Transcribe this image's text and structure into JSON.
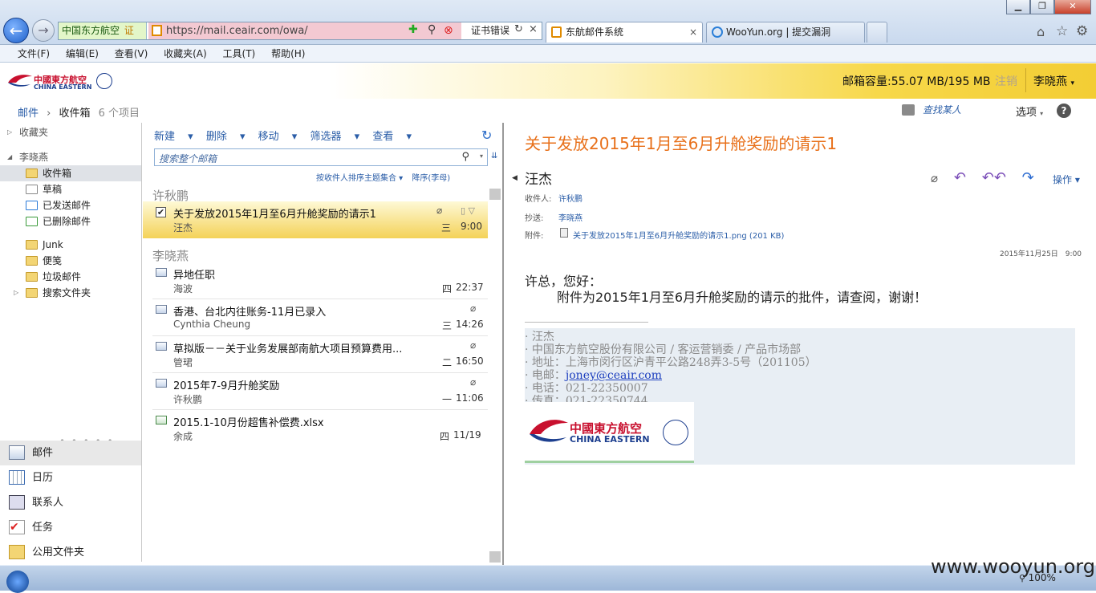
{
  "browser": {
    "cert_label": "中国东方航空",
    "cert_badge": "证",
    "url": "https://mail.ceair.com/owa/",
    "cert_error": "证书错误",
    "tabs": [
      {
        "label": "东航邮件系统",
        "close": "×"
      },
      {
        "label": "WooYun.org | 提交漏洞"
      }
    ],
    "menu": [
      "文件(F)",
      "编辑(E)",
      "查看(V)",
      "收藏夹(A)",
      "工具(T)",
      "帮助(H)"
    ],
    "zoom": "100%"
  },
  "header": {
    "logo_cn": "中國東方航空",
    "logo_en": "CHINA EASTERN",
    "quota": "邮箱容量:55.07 MB/195 MB",
    "logout": "注销",
    "user": "李晓燕"
  },
  "breadcrumb": {
    "root": "邮件",
    "sep": "›",
    "folder": "收件箱",
    "count": "6 个项目"
  },
  "find_people": "查找某人",
  "options": "选项",
  "help": "?",
  "nav": {
    "favorites": "收藏夹",
    "account": "李晓燕",
    "folders": [
      "收件箱",
      "草稿",
      "已发送邮件",
      "已删除邮件",
      "Junk",
      "便笺",
      "垃圾邮件",
      "搜索文件夹"
    ],
    "grip": "• • • • •",
    "bottom": [
      "邮件",
      "日历",
      "联系人",
      "任务",
      "公用文件夹"
    ]
  },
  "list": {
    "toolbar": [
      "新建",
      "删除",
      "移动",
      "筛选器",
      "查看"
    ],
    "search_placeholder": "搜索整个邮箱",
    "sort_by": "按收件人排序主题集合",
    "sort_order": "降序(李母)",
    "groups": [
      "许秋鹏",
      "李晓燕"
    ],
    "messages": [
      {
        "subject": "关于发放2015年1月至6月升舱奖励的请示1",
        "from": "汪杰",
        "day": "三",
        "time": "9:00"
      },
      {
        "subject": "异地任职",
        "from": "海波",
        "day": "四",
        "time": "22:37"
      },
      {
        "subject": "香港、台北内往账务-11月已录入",
        "from": "Cynthia Cheung",
        "day": "三",
        "time": "14:26"
      },
      {
        "subject": "草拟版－－关于业务发展部南航大项目预算费用...",
        "from": "管珺",
        "day": "二",
        "time": "16:50"
      },
      {
        "subject": "2015年7-9月升舱奖励",
        "from": "许秋鹏",
        "day": "一",
        "time": "11:06"
      },
      {
        "subject": "2015.1-10月份超售补偿费.xlsx",
        "from": "余成",
        "day": "四",
        "time": "11/19"
      }
    ]
  },
  "reading": {
    "title": "关于发放2015年1月至6月升舱奖励的请示1",
    "from": "汪杰",
    "to_label": "收件人:",
    "to": "许秋鹏",
    "cc_label": "抄送:",
    "cc": "李晓燕",
    "att_label": "附件:",
    "attachment": "关于发放2015年1月至6月升舱奖励的请示1.png (201 KB)",
    "actions_label": "操作",
    "date": "2015年11月25日　9:00",
    "greeting": "许总，您好：",
    "body": "附件为2015年1月至6月升舱奖励的请示的批件，请查阅，谢谢！",
    "signature": [
      "· 汪杰",
      "· 中国东方航空股份有限公司 / 客运营销委 / 产品市场部",
      "· 地址：上海市闵行区沪青平公路248弄3-5号（201105）",
      "· 电邮：",
      "· 电话：021-22350007",
      "· 传真：021-22350744"
    ],
    "email": "joney@ceair.com"
  },
  "watermark": "www.wooyun.org"
}
